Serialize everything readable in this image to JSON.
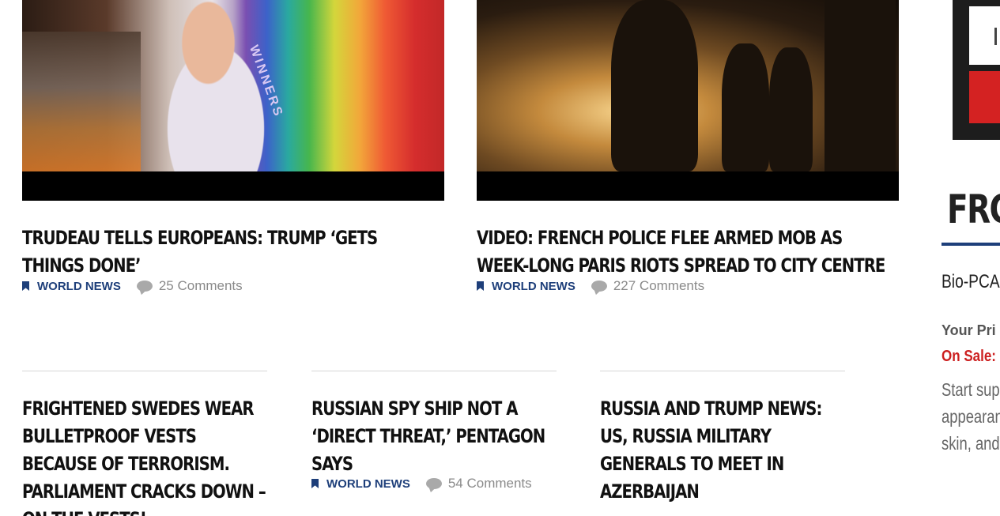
{
  "featured": [
    {
      "title": "TRUDEAU TELLS EUROPEANS: TRUMP ‘GETS THINGS DONE’",
      "category": "WORLD NEWS",
      "comments": "25 Comments",
      "image_text": "WINNERS"
    },
    {
      "title": "VIDEO: FRENCH POLICE FLEE ARMED MOB AS WEEK-LONG PARIS RIOTS SPREAD TO CITY CENTRE",
      "category": "WORLD NEWS",
      "comments": "227 Comments"
    }
  ],
  "articles": [
    {
      "title": "FRIGHTENED SWEDES WEAR BULLETPROOF VESTS BECAUSE OF TERRORISM. PARLIAMENT CRACKS DOWN – ON THE VESTS!"
    },
    {
      "title": "RUSSIAN SPY SHIP NOT A ‘DIRECT THREAT,’ PENTAGON SAYS",
      "category": "WORLD NEWS",
      "comments": "54 Comments"
    },
    {
      "title": "RUSSIA AND TRUMP NEWS: US, RUSSIA MILITARY GENERALS TO MEET IN AZERBAIJAN"
    }
  ],
  "sidebar": {
    "section_title": "FRC",
    "product_name": "Bio-PCA",
    "tagline": "Your Pri",
    "sale_label": "On Sale:",
    "desc_lines": [
      "Start sup",
      "appearan",
      "skin, and"
    ]
  },
  "colors": {
    "category_blue": "#1e3f7a",
    "sale_red": "#cc1f1f",
    "meta_gray": "#8a8a8a"
  }
}
